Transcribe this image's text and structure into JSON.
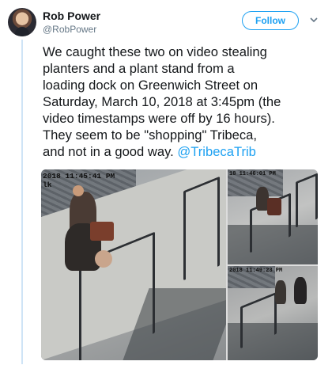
{
  "user": {
    "name": "Rob Power",
    "handle": "@RobPower"
  },
  "follow_label": "Follow",
  "tweet_text": "We caught these two on video stealing\nplanters and a plant stand from a\nloading dock on Greenwich Street on\nSaturday, March 10, 2018 at 3:45pm (the\nvideo timestamps were off by 16 hours).\nThey seem to be \"shopping\" Tribeca,\nand not in a good way.",
  "mention": "@TribecaTrib",
  "media": {
    "timestamp_main": "2018 11:45:41 PM",
    "timestamp_main_sub": "lk",
    "timestamp_tr": "18 11:46:01 PM",
    "timestamp_br": "2018 11:49:23 PM"
  }
}
